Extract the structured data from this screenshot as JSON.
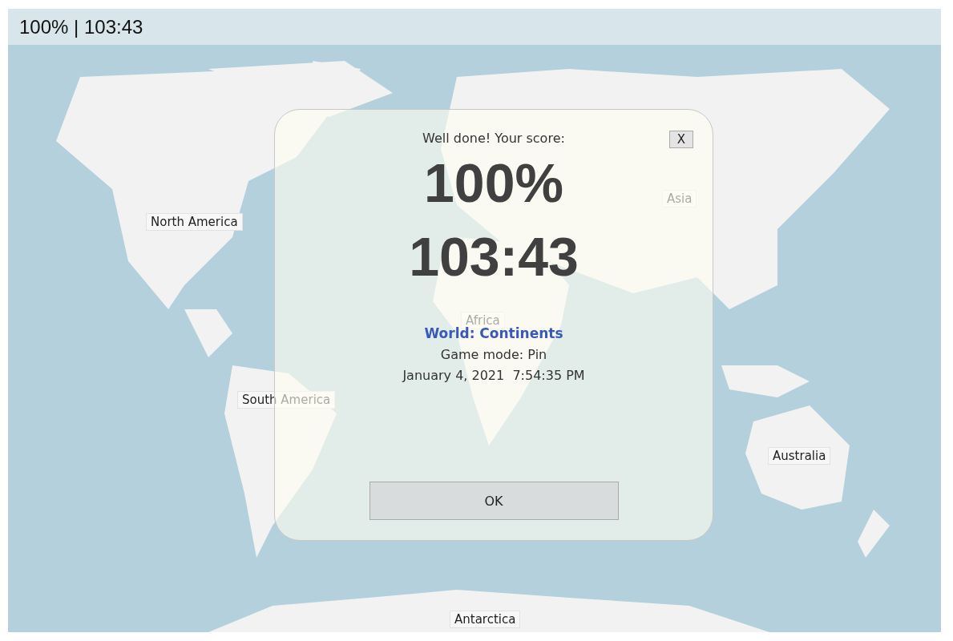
{
  "status_bar": {
    "text": "100% | 103:43"
  },
  "map_labels": [
    {
      "label": "North America"
    },
    {
      "label": "South America"
    },
    {
      "label": "Asia"
    },
    {
      "label": "Africa"
    },
    {
      "label": "Australia"
    },
    {
      "label": "Antarctica"
    }
  ],
  "dialog": {
    "heading": "Well done! Your score:",
    "close_button": "X",
    "score": "100%",
    "time": "103:43",
    "quiz_title": "World: Continents",
    "game_mode": "Game mode: Pin",
    "date": "January 4, 2021  7:54:35 PM",
    "ok_button": "OK"
  }
}
